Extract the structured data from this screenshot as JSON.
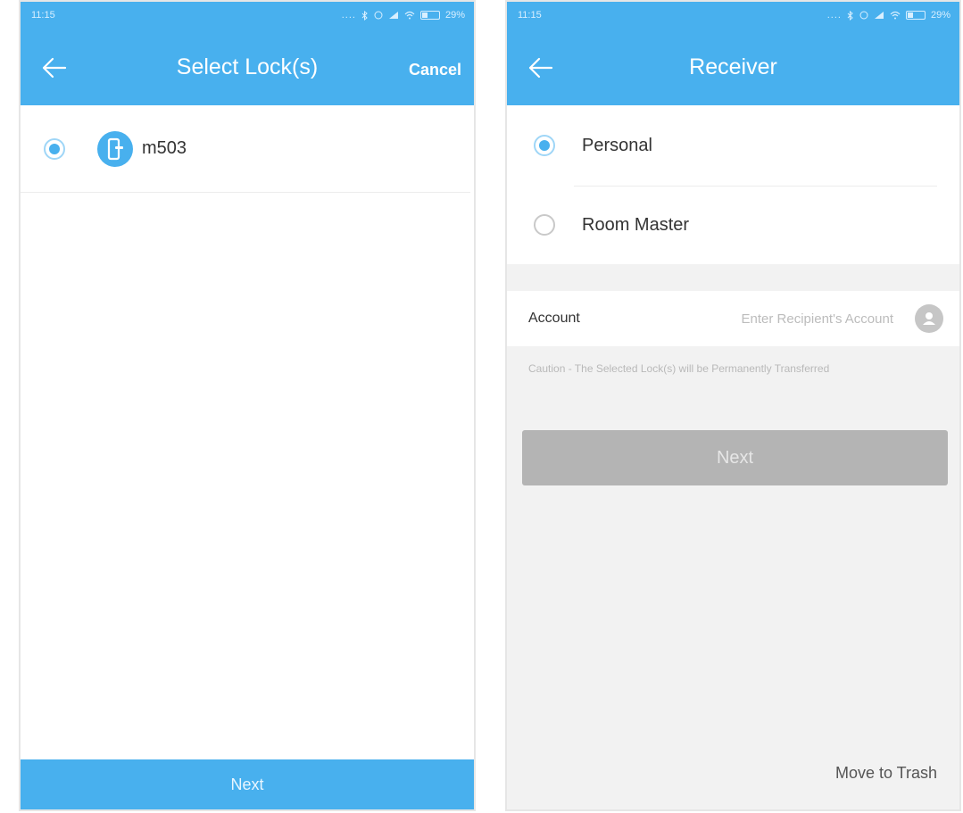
{
  "left_screen": {
    "status_time": "11:15",
    "status_dots": "....",
    "battery": "29%",
    "title": "Select Lock(s)",
    "cancel_label": "Cancel",
    "locks": [
      {
        "name": "m503",
        "selected": true
      }
    ],
    "next_label": "Next"
  },
  "right_screen": {
    "status_time": "11:15",
    "status_dots": "....",
    "battery": "29%",
    "title": "Receiver",
    "options": [
      {
        "label": "Personal",
        "selected": true
      },
      {
        "label": "Room Master",
        "selected": false
      }
    ],
    "account_label": "Account",
    "account_placeholder": "Enter Recipient's Account",
    "account_value": "",
    "caution": "Caution - The Selected Lock(s) will be Permanently Transferred",
    "next_label": "Next",
    "trash_label": "Move to Trash"
  },
  "colors": {
    "accent": "#48b0ee",
    "disabled_button": "#b4b4b4",
    "background_gray": "#f2f2f2"
  },
  "icons": {
    "back": "arrow-left-icon",
    "lock": "door-lock-icon",
    "contact": "contact-person-icon",
    "signal": "signal-icon",
    "wifi": "wifi-icon",
    "battery": "battery-icon"
  }
}
